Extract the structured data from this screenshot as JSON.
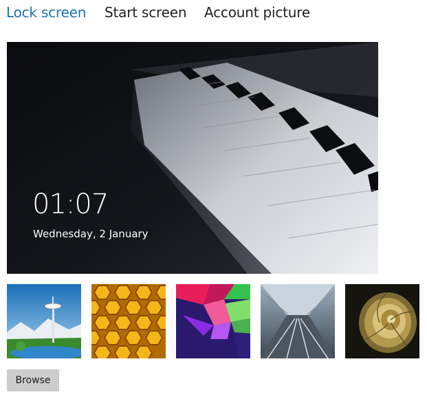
{
  "tabs": [
    {
      "label": "Lock screen",
      "active": true
    },
    {
      "label": "Start screen",
      "active": false
    },
    {
      "label": "Account picture",
      "active": false
    }
  ],
  "preview": {
    "time": "01:07",
    "date": "Wednesday, 2 January"
  },
  "browse_label": "Browse",
  "colors": {
    "active_tab": "#1a73b3",
    "text": "#1f1f1f",
    "button_bg": "#cccccc"
  }
}
